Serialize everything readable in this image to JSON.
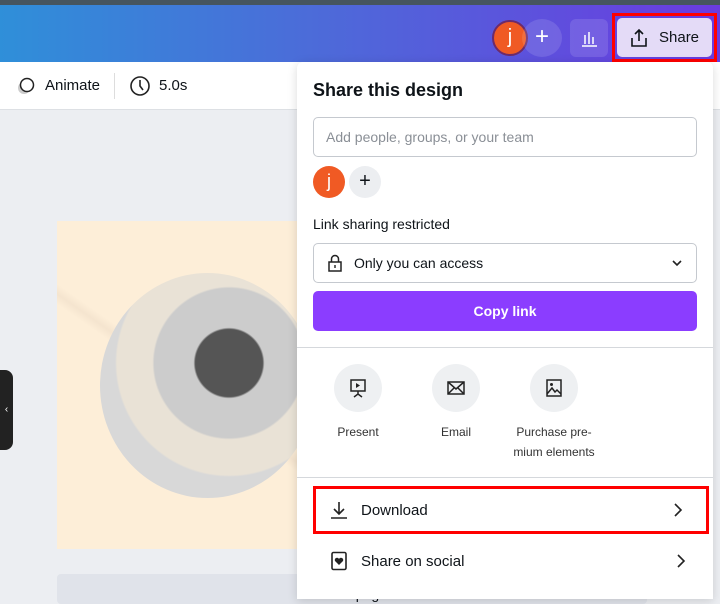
{
  "header": {
    "avatar_initial": "j",
    "add_label": "+",
    "share_label": "Share"
  },
  "toolbar": {
    "animate_label": "Animate",
    "duration": "5.0s"
  },
  "canvas": {
    "add_page_label": "Add page"
  },
  "share_panel": {
    "title": "Share this design",
    "people_placeholder": "Add people, groups, or your team",
    "collaborator_initial": "j",
    "add_collaborator": "+",
    "link_label": "Link sharing restricted",
    "access_value": "Only you can access",
    "copy_link": "Copy link",
    "options": [
      {
        "label": "Present",
        "icon": "presentation-icon"
      },
      {
        "label": "Email",
        "icon": "envelope-icon"
      },
      {
        "label": "Purchase pre-mium elements",
        "icon": "image-icon"
      }
    ],
    "rows": [
      {
        "label": "Download",
        "icon": "download-icon"
      },
      {
        "label": "Share on social",
        "icon": "social-heart-icon"
      }
    ]
  },
  "colors": {
    "accent": "#8b3dff",
    "avatar": "#f05a24",
    "highlight": "#ff0000"
  }
}
